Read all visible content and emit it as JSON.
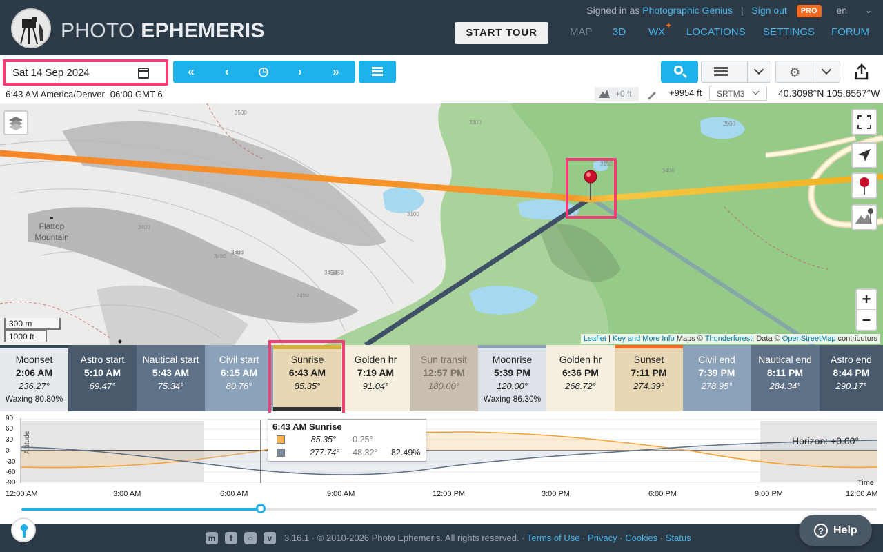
{
  "header": {
    "title_thin": "PHOTO",
    "title_bold": "EPHEMERIS",
    "signed_in_prefix": "Signed in as",
    "user": "Photographic Genius",
    "sign_out": "Sign out",
    "pro_badge": "PRO",
    "language": "en",
    "start_tour": "START TOUR",
    "nav": [
      "MAP",
      "3D",
      "WX",
      "LOCATIONS",
      "SETTINGS",
      "FORUM"
    ]
  },
  "toolbar": {
    "date": "Sat 14 Sep 2024",
    "timezone_info": "6:43 AM America/Denver -06:00 GMT-6",
    "marker_elevation": "+0 ft",
    "elevation": "+9954 ft",
    "elevation_model": "SRTM3",
    "coordinates": "40.3098°N 105.6567°W"
  },
  "map": {
    "scale_metric": "300 m",
    "scale_imperial": "1000 ft",
    "place_label": "Flattop Mountain",
    "contour_labels": [
      "3500",
      "3400",
      "3450",
      "3450",
      "3500",
      "3450",
      "3100",
      "3500",
      "3250",
      "3300",
      "2900",
      "3150",
      "2900",
      "3400"
    ],
    "attribution": {
      "leaflet": "Leaflet",
      "sep1": " | ",
      "key_info": "Key and More Info",
      "maps_prefix": " Maps © ",
      "thunderforest": "Thunderforest",
      "data_prefix": ", Data © ",
      "osm": "OpenStreetMap",
      "suffix": " contributors"
    }
  },
  "events": [
    {
      "name": "Moonset",
      "time": "2:06 AM",
      "azimuth": "236.27°",
      "extra": "Waxing 80.80%"
    },
    {
      "name": "Astro start",
      "time": "5:10 AM",
      "azimuth": "69.47°",
      "extra": ""
    },
    {
      "name": "Nautical start",
      "time": "5:43 AM",
      "azimuth": "75.34°",
      "extra": ""
    },
    {
      "name": "Civil start",
      "time": "6:15 AM",
      "azimuth": "80.76°",
      "extra": ""
    },
    {
      "name": "Sunrise",
      "time": "6:43 AM",
      "azimuth": "85.35°",
      "extra": ""
    },
    {
      "name": "Golden hr",
      "time": "7:19 AM",
      "azimuth": "91.04°",
      "extra": ""
    },
    {
      "name": "Sun transit",
      "time": "12:57 PM",
      "azimuth": "180.00°",
      "extra": ""
    },
    {
      "name": "Moonrise",
      "time": "5:39 PM",
      "azimuth": "120.00°",
      "extra": "Waxing 86.30%"
    },
    {
      "name": "Golden hr",
      "time": "6:36 PM",
      "azimuth": "268.72°",
      "extra": ""
    },
    {
      "name": "Sunset",
      "time": "7:11 PM",
      "azimuth": "274.39°",
      "extra": ""
    },
    {
      "name": "Civil end",
      "time": "7:39 PM",
      "azimuth": "278.95°",
      "extra": ""
    },
    {
      "name": "Nautical end",
      "time": "8:11 PM",
      "azimuth": "284.34°",
      "extra": ""
    },
    {
      "name": "Astro end",
      "time": "8:44 PM",
      "azimuth": "290.17°",
      "extra": ""
    }
  ],
  "graph": {
    "altitude_label": "Altitude",
    "y_ticks": [
      "90",
      "60",
      "30",
      "0",
      "-30",
      "-60",
      "-90"
    ],
    "x_ticks": [
      "12:00 AM",
      "3:00 AM",
      "6:00 AM",
      "9:00 AM",
      "12:00 PM",
      "3:00 PM",
      "6:00 PM",
      "9:00 PM",
      "12:00 AM"
    ],
    "horizon": "Horizon: +0.00°",
    "time_label": "Time",
    "tooltip": {
      "title": "6:43 AM Sunrise",
      "sun_azimuth": "85.35°",
      "sun_altitude": "-0.25°",
      "moon_azimuth": "277.74°",
      "moon_altitude": "-48.32°",
      "moon_illumination": "82.49%"
    },
    "slider_fraction": 0.28
  },
  "footer": {
    "text_prefix": "3.16.1 · © 2010-2026 Photo Ephemeris. All rights reserved. ·",
    "links": [
      "Terms of Use",
      "Privacy",
      "Cookies",
      "Status"
    ],
    "help": "Help"
  },
  "colors": {
    "accent": "#1fb2ea",
    "highlight": "#ef3f74",
    "header_bg": "#2c3a47",
    "sun_line": "#f5872a",
    "moon_line": "#3e4f66"
  }
}
